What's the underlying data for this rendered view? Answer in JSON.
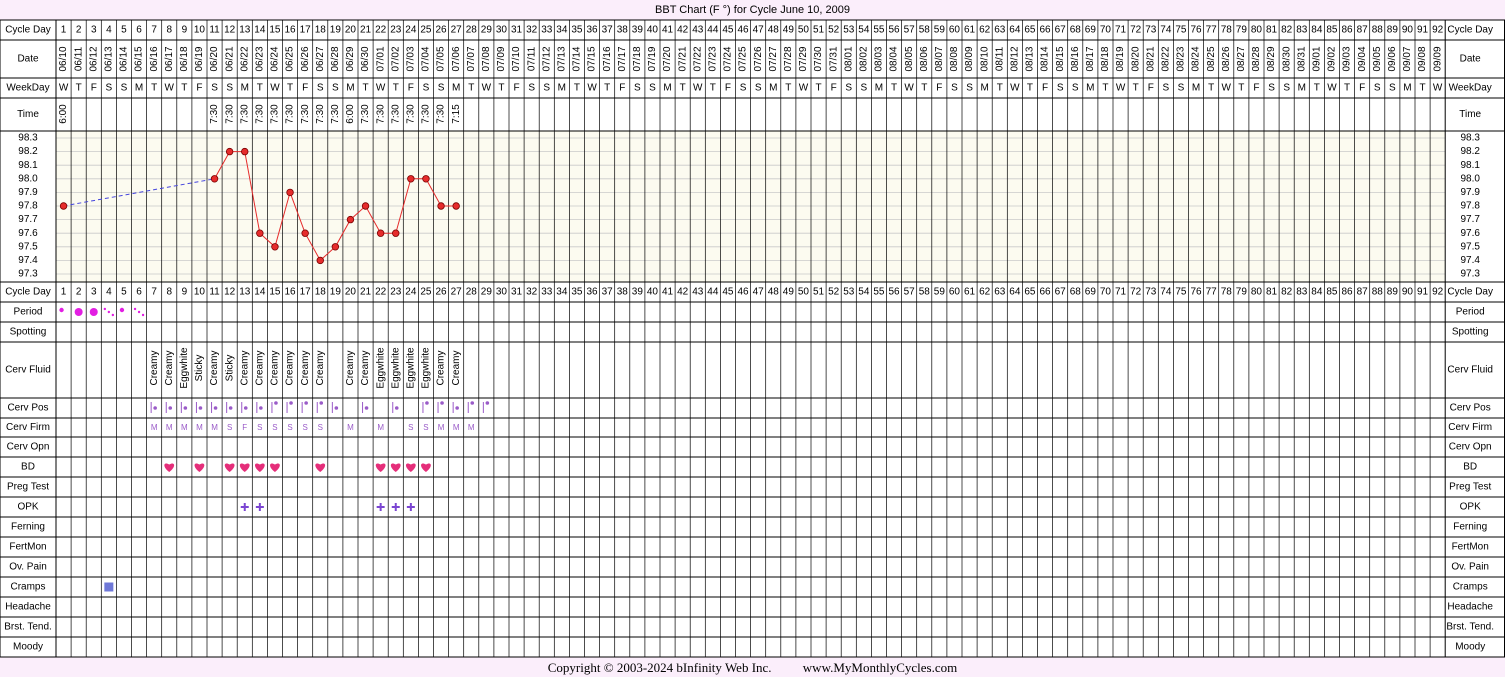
{
  "chart_title": "BBT Chart (F °) for Cycle June 10, 2009",
  "row_labels": {
    "cycle_day": "Cycle Day",
    "date": "Date",
    "weekday": "WeekDay",
    "time": "Time",
    "period": "Period",
    "spotting": "Spotting",
    "cerv_fluid": "Cerv Fluid",
    "cerv_pos": "Cerv Pos",
    "cerv_firm": "Cerv Firm",
    "cerv_opn": "Cerv Opn",
    "bd": "BD",
    "preg_test": "Preg Test",
    "opk": "OPK",
    "ferning": "Ferning",
    "fertmon": "FertMon",
    "ov_pain": "Ov. Pain",
    "cramps": "Cramps",
    "headache": "Headache",
    "brst_tend": "Brst. Tend.",
    "moody": "Moody"
  },
  "days": {
    "dates": [
      "06/10",
      "06/11",
      "06/12",
      "06/13",
      "06/14",
      "06/15",
      "06/16",
      "06/17",
      "06/18",
      "06/19",
      "06/20",
      "06/21",
      "06/22",
      "06/23",
      "06/24",
      "06/25",
      "06/26",
      "06/27",
      "06/28",
      "06/29",
      "06/30",
      "07/01",
      "07/02",
      "07/03",
      "07/04",
      "07/05",
      "07/06",
      "07/07",
      "07/08",
      "07/09",
      "07/10",
      "07/11",
      "07/12",
      "07/13",
      "07/14",
      "07/15",
      "07/16",
      "07/17",
      "07/18",
      "07/19",
      "07/20",
      "07/21",
      "07/22",
      "07/23",
      "07/24",
      "07/25",
      "07/26",
      "07/27",
      "07/28",
      "07/29",
      "07/30",
      "07/31",
      "08/01",
      "08/02",
      "08/03",
      "08/04",
      "08/05",
      "08/06",
      "08/07",
      "08/08",
      "08/09",
      "08/10",
      "08/11",
      "08/12",
      "08/13",
      "08/14",
      "08/15",
      "08/16",
      "08/17",
      "08/18",
      "08/19",
      "08/20",
      "08/21",
      "08/22",
      "08/23",
      "08/24",
      "08/25",
      "08/26",
      "08/27",
      "08/28",
      "08/29",
      "08/30",
      "08/31",
      "09/01",
      "09/02",
      "09/03",
      "09/04",
      "09/05",
      "09/06",
      "09/07",
      "09/08",
      "09/09"
    ],
    "weekdays": [
      "W",
      "T",
      "F",
      "S",
      "S",
      "M",
      "T",
      "W",
      "T",
      "F",
      "S",
      "S",
      "M",
      "T",
      "W",
      "T",
      "F",
      "S",
      "S",
      "M",
      "T",
      "W",
      "T",
      "F",
      "S",
      "S",
      "M",
      "T",
      "W",
      "T",
      "F",
      "S",
      "S",
      "M",
      "T",
      "W",
      "T",
      "F",
      "S",
      "S",
      "M",
      "T",
      "W",
      "T",
      "F",
      "S",
      "S",
      "M",
      "T",
      "W",
      "T",
      "F",
      "S",
      "S",
      "M",
      "T",
      "W",
      "T",
      "F",
      "S",
      "S",
      "M",
      "T",
      "W",
      "T",
      "F",
      "S",
      "S",
      "M",
      "T",
      "W",
      "T",
      "F",
      "S",
      "S",
      "M",
      "T",
      "W",
      "T",
      "F",
      "S",
      "S",
      "M",
      "T",
      "W",
      "T",
      "F",
      "S",
      "S",
      "M",
      "T",
      "W"
    ],
    "times": [
      "6:00",
      "",
      "",
      "",
      "",
      "",
      "",
      "",
      "",
      "",
      "7:30",
      "7:30",
      "7:30",
      "7:30",
      "7:30",
      "7:30",
      "7:30",
      "7:30",
      "7:30",
      "6:00",
      "7:30",
      "7:30",
      "7:30",
      "7:30",
      "7:30",
      "7:30",
      "7:15"
    ],
    "cervical_fluid": [
      "",
      "",
      "",
      "",
      "",
      "",
      "Creamy",
      "Creamy",
      "Eggwhite",
      "Sticky",
      "Creamy",
      "Sticky",
      "Creamy",
      "Creamy",
      "Creamy",
      "Creamy",
      "Creamy",
      "Creamy",
      "",
      "Creamy",
      "Creamy",
      "Eggwhite",
      "Eggwhite",
      "Eggwhite",
      "Eggwhite",
      "Creamy",
      "Creamy"
    ],
    "cerv_pos": [
      0,
      0,
      0,
      0,
      0,
      0,
      2,
      1,
      1,
      1,
      1,
      2,
      1,
      2,
      3,
      3,
      3,
      3,
      1,
      0,
      2,
      0,
      2,
      0,
      3,
      3,
      2,
      3,
      3
    ],
    "cerv_firm": [
      "",
      "",
      "",
      "",
      "",
      "",
      "M",
      "M",
      "M",
      "M",
      "M",
      "S",
      "F",
      "S",
      "S",
      "S",
      "S",
      "S",
      "",
      "M",
      "",
      "M",
      "",
      "S",
      "S",
      "M",
      "M",
      "M"
    ],
    "bd": [
      false,
      false,
      false,
      false,
      false,
      false,
      false,
      true,
      false,
      true,
      false,
      true,
      true,
      true,
      true,
      false,
      false,
      true,
      false,
      false,
      false,
      true,
      true,
      true,
      true,
      false,
      false
    ],
    "opk_positive": [
      13,
      14,
      22,
      23,
      24
    ],
    "period": [
      "dot",
      "big",
      "big",
      "light",
      "dot",
      "light"
    ],
    "cramps_days": [
      4
    ]
  },
  "chart_data": {
    "type": "line",
    "title": "BBT Chart (F °) for Cycle June 10, 2009",
    "x_label": "Cycle Day",
    "x": [
      1,
      2,
      3,
      4,
      5,
      6,
      7,
      8,
      9,
      10,
      11,
      12,
      13,
      14,
      15,
      16,
      17,
      18,
      19,
      20,
      21,
      22,
      23,
      24,
      25,
      26,
      27,
      28,
      29,
      30,
      31,
      32,
      33,
      34,
      35,
      36,
      37,
      38,
      39,
      40,
      41,
      42,
      43,
      44,
      45,
      46,
      47,
      48,
      49,
      50,
      51,
      52,
      53,
      54,
      55,
      56,
      57,
      58,
      59,
      60,
      61,
      62,
      63,
      64,
      65,
      66,
      67,
      68,
      69,
      70,
      71,
      72,
      73,
      74,
      75,
      76,
      77,
      78,
      79,
      80,
      81,
      82,
      83,
      84,
      85,
      86,
      87,
      88,
      89,
      90,
      91,
      92
    ],
    "y_ticks": [
      98.3,
      98.2,
      98.1,
      98.0,
      97.9,
      97.8,
      97.7,
      97.6,
      97.5,
      97.4,
      97.3
    ],
    "ylim": [
      97.3,
      98.3
    ],
    "series": [
      {
        "values": [
          97.8,
          null,
          null,
          null,
          null,
          null,
          null,
          null,
          null,
          null,
          98.0,
          98.2,
          98.2,
          97.6,
          97.5,
          97.9,
          97.6,
          97.4,
          97.5,
          97.7,
          97.8,
          97.6,
          97.6,
          98.0,
          98.0,
          97.8,
          97.8
        ]
      }
    ],
    "dashed_gap": [
      1,
      11
    ],
    "colors": {
      "line": "#e62c2c",
      "dashed": "#4444dd",
      "marker_fill": "#e62c2c",
      "plot_bg": "#fcfbf0"
    }
  },
  "colors": {
    "page_bg": "#fbeefb",
    "period": "#e21ee2",
    "cerv": "#9a5bc8",
    "bd": "#e52e7a",
    "opk": "#7b45d2",
    "cramps": "#6f78d8"
  },
  "footer": {
    "copyright": "Copyright © 2003-2024 bInfinity Web Inc.",
    "site": "www.MyMonthlyCycles.com"
  }
}
